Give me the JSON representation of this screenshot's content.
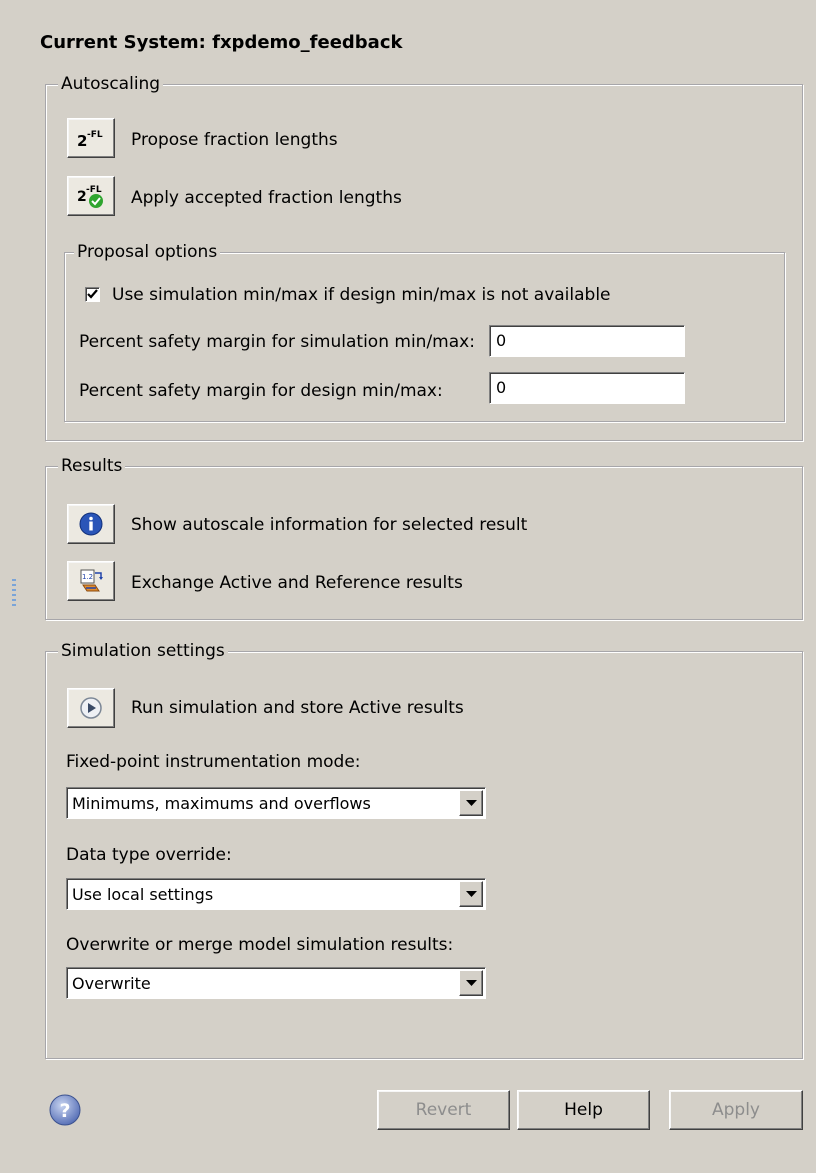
{
  "header": {
    "title": "Current System: fxpdemo_feedback"
  },
  "autoscaling": {
    "legend": "Autoscaling",
    "propose_label": "Propose fraction lengths",
    "apply_label": "Apply accepted fraction lengths",
    "proposal_options": {
      "legend": "Proposal options",
      "use_sim_checkbox_label": "Use simulation min/max if design min/max is not available",
      "use_sim_checked": true,
      "sim_margin_label": "Percent safety margin for simulation min/max:",
      "sim_margin_value": "0",
      "design_margin_label": "Percent safety margin for design min/max:",
      "design_margin_value": "0"
    }
  },
  "results": {
    "legend": "Results",
    "show_info_label": "Show autoscale information for selected result",
    "exchange_label": "Exchange Active and Reference results"
  },
  "simulation": {
    "legend": "Simulation settings",
    "run_label": "Run simulation and store Active results",
    "instr_mode_label": "Fixed-point instrumentation mode:",
    "instr_mode_value": "Minimums, maximums and overflows",
    "dt_override_label": "Data type override:",
    "dt_override_value": "Use local settings",
    "merge_label": "Overwrite or merge model simulation results:",
    "merge_value": "Overwrite"
  },
  "footer": {
    "revert_label": "Revert",
    "help_label": "Help",
    "apply_label": "Apply"
  },
  "icons": {
    "propose": "power-of-two-fl-icon",
    "apply": "power-of-two-fl-check-icon",
    "info": "info-icon",
    "exchange": "exchange-icon",
    "run": "play-icon",
    "help": "question-icon"
  },
  "colors": {
    "background": "#d4d0c8",
    "info_blue": "#2a55b8",
    "check_green": "#2fa52f"
  }
}
